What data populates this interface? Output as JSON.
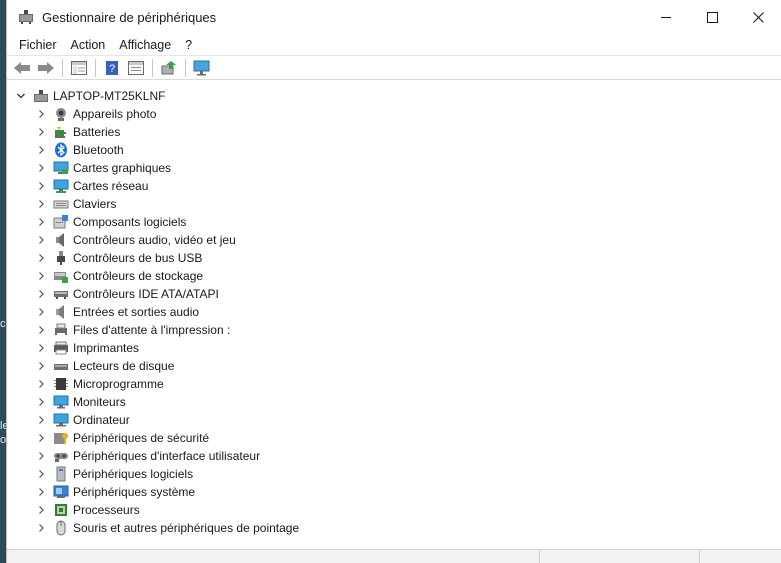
{
  "window": {
    "title": "Gestionnaire de périphériques"
  },
  "menu": {
    "items": [
      "Fichier",
      "Action",
      "Affichage",
      "?"
    ]
  },
  "tree": {
    "root_label": "LAPTOP-MT25KLNF",
    "categories": [
      {
        "label": "Appareils photo",
        "icon": "camera-icon"
      },
      {
        "label": "Batteries",
        "icon": "battery-icon"
      },
      {
        "label": "Bluetooth",
        "icon": "bluetooth-icon"
      },
      {
        "label": "Cartes graphiques",
        "icon": "display-adapter-icon"
      },
      {
        "label": "Cartes réseau",
        "icon": "network-adapter-icon"
      },
      {
        "label": "Claviers",
        "icon": "keyboard-icon"
      },
      {
        "label": "Composants logiciels",
        "icon": "software-component-icon"
      },
      {
        "label": "Contrôleurs audio, vidéo et jeu",
        "icon": "speaker-icon"
      },
      {
        "label": "Contrôleurs de bus USB",
        "icon": "usb-icon"
      },
      {
        "label": "Contrôleurs de stockage",
        "icon": "storage-controller-icon"
      },
      {
        "label": "Contrôleurs IDE ATA/ATAPI",
        "icon": "ide-controller-icon"
      },
      {
        "label": "Entrées et sorties audio",
        "icon": "audio-io-icon"
      },
      {
        "label": "Files d'attente à l'impression :",
        "icon": "print-queue-icon"
      },
      {
        "label": "Imprimantes",
        "icon": "printer-icon"
      },
      {
        "label": "Lecteurs de disque",
        "icon": "disk-drive-icon"
      },
      {
        "label": "Microprogramme",
        "icon": "firmware-icon"
      },
      {
        "label": "Moniteurs",
        "icon": "monitor-icon"
      },
      {
        "label": "Ordinateur",
        "icon": "computer-icon"
      },
      {
        "label": "Périphériques de sécurité",
        "icon": "security-device-icon"
      },
      {
        "label": "Périphériques d'interface utilisateur",
        "icon": "hid-icon"
      },
      {
        "label": "Périphériques logiciels",
        "icon": "software-device-icon"
      },
      {
        "label": "Périphériques système",
        "icon": "system-device-icon"
      },
      {
        "label": "Processeurs",
        "icon": "processor-icon"
      },
      {
        "label": "Souris et autres périphériques de pointage",
        "icon": "mouse-icon"
      }
    ]
  },
  "desktop_fragments": [
    "ch",
    "le",
    "o"
  ]
}
